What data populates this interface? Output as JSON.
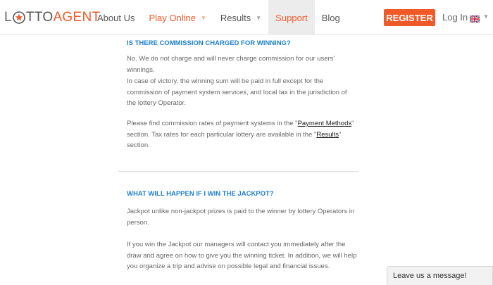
{
  "header": {
    "logo": {
      "text_l": "L",
      "text_tto": "TTO",
      "text_agent": "AGENT"
    },
    "nav": {
      "about": "About Us",
      "play_online": "Play Online",
      "results": "Results",
      "support": "Support",
      "blog": "Blog"
    },
    "register_label": "REGISTER",
    "login_label": "Log In"
  },
  "faq": [
    {
      "question": "IS THERE COMMISSION CHARGED FOR WINNING?",
      "p1": "No. We do not charge and will never charge commission for our users' winnings.",
      "p2": "In case of victory, the winning sum will be paid in full except for the commission of payment system services, and local tax in the jurisdiction of the lottery Operator.",
      "p3_a": "Please find commission rates of payment systems in the \"",
      "p3_link1": "Payment Methods",
      "p3_b": "\" section. Tax rates for each particular lottery are available in the \"",
      "p3_link2": "Results",
      "p3_c": "\" section."
    },
    {
      "question": "WHAT WILL HAPPEN IF I WIN THE JACKPOT?",
      "p1": "Jackpot unlike non-jackpot prizes is paid to the winner by lottery Operators in person.",
      "p2": "If you win the Jackpot our managers will contact you immediately after the draw and agree on how to give you the winning ticket. In addition, we will help you organize a trip and advise on possible legal and financial issues."
    }
  ],
  "chat": {
    "label": "Leave us a message!"
  },
  "colors": {
    "accent": "#f05a28",
    "question_blue": "#1e7fcc"
  },
  "icons": [
    "lottery-ball-icon",
    "uk-flag-icon",
    "chevron-down-icon"
  ]
}
